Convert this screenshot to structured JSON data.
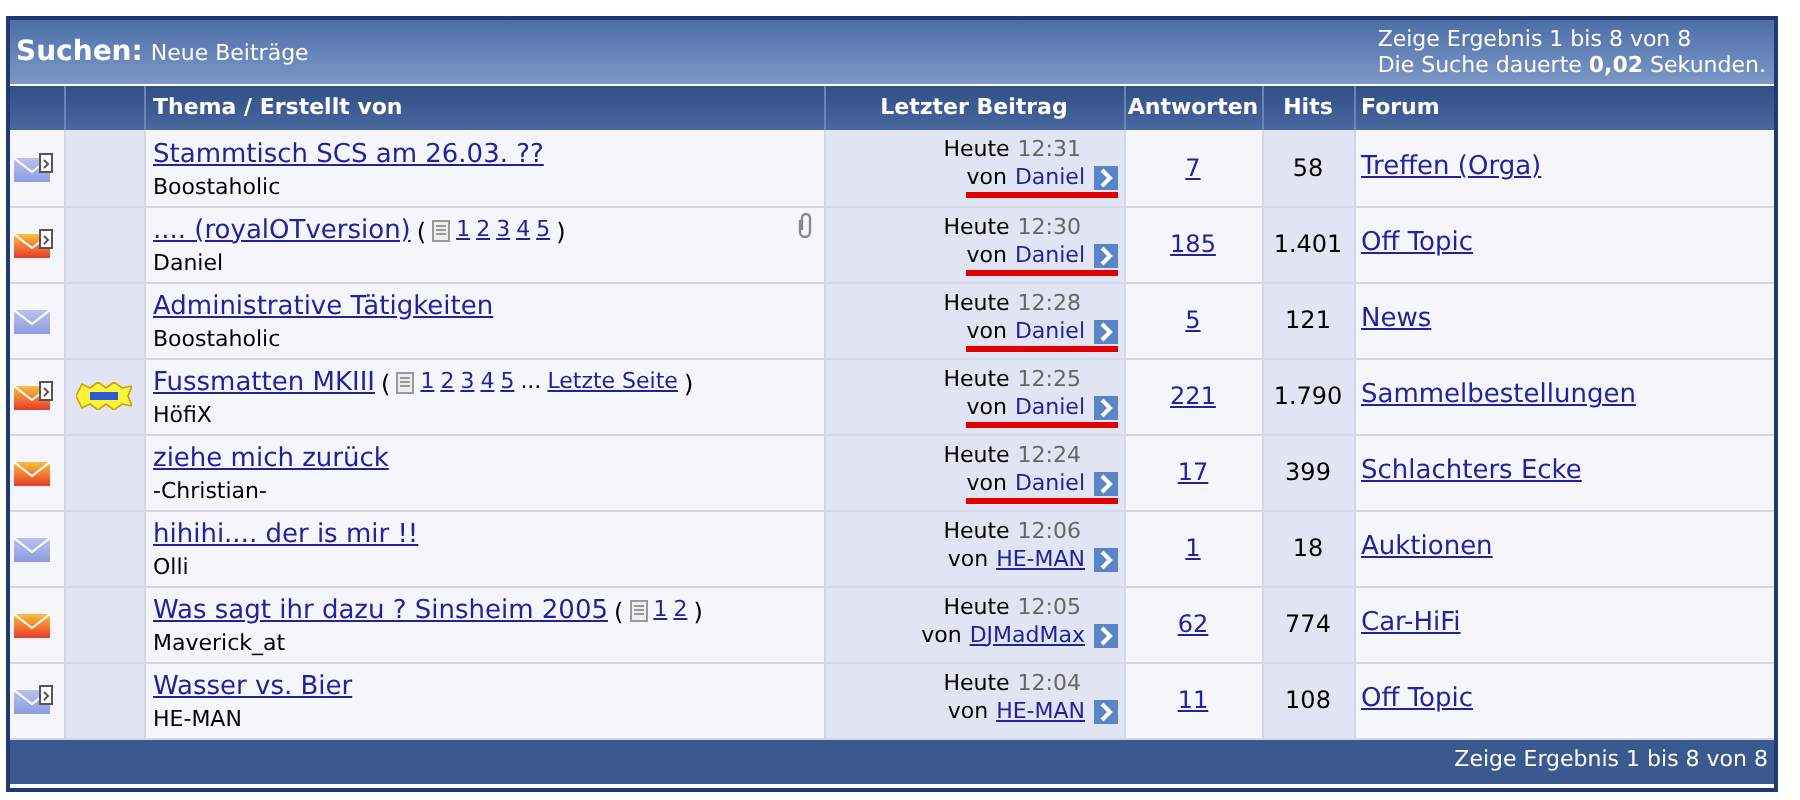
{
  "header": {
    "title": "Suchen:",
    "subtitle": "Neue Beiträge",
    "results": "Zeige Ergebnis 1 bis 8 von 8",
    "duration": "Die Suche dauerte **0,02** Sekunden."
  },
  "columns": [
    "Thema / Erstellt von",
    "Letzter Beitrag",
    "Antworten",
    "Hits",
    "Forum"
  ],
  "rows": [
    {
      "unread": false,
      "replied": true,
      "new": false,
      "title": "Stammtisch SCS am 26.03. ??",
      "pager": null,
      "attachment": false,
      "author": "Boostaholic",
      "day": "Heute",
      "time": "12:31",
      "von": "von",
      "last_by": "Daniel",
      "highlighted": true,
      "replies": "7",
      "hits": "58",
      "forum": "Treffen (Orga)"
    },
    {
      "unread": true,
      "replied": true,
      "new": false,
      "title": ".... (royalOTversion)",
      "pager": {
        "open": "(",
        "pages": [
          "1",
          "2",
          "3",
          "4",
          "5"
        ],
        "close": ")"
      },
      "attachment": true,
      "author": "Daniel",
      "day": "Heute",
      "time": "12:30",
      "von": "von",
      "last_by": "Daniel",
      "highlighted": true,
      "replies": "185",
      "hits": "1.401",
      "forum": "Off Topic"
    },
    {
      "unread": false,
      "replied": false,
      "new": false,
      "title": "Administrative Tätigkeiten",
      "pager": null,
      "attachment": false,
      "author": "Boostaholic",
      "day": "Heute",
      "time": "12:28",
      "von": "von",
      "last_by": "Daniel",
      "highlighted": true,
      "replies": "5",
      "hits": "121",
      "forum": "News"
    },
    {
      "unread": true,
      "replied": true,
      "new": true,
      "title": "Fussmatten MKIII",
      "pager": {
        "open": "(",
        "pages": [
          "1",
          "2",
          "3",
          "4",
          "5"
        ],
        "ellipsis": "...",
        "last_page": "Letzte Seite",
        "close": ")"
      },
      "attachment": false,
      "author": "HöfiX",
      "day": "Heute",
      "time": "12:25",
      "von": "von",
      "last_by": "Daniel",
      "highlighted": true,
      "replies": "221",
      "hits": "1.790",
      "forum": "Sammelbestellungen"
    },
    {
      "unread": true,
      "replied": false,
      "new": false,
      "title": "ziehe mich zurück",
      "pager": null,
      "attachment": false,
      "author": "-Christian-",
      "day": "Heute",
      "time": "12:24",
      "von": "von",
      "last_by": "Daniel",
      "highlighted": true,
      "replies": "17",
      "hits": "399",
      "forum": "Schlachters Ecke"
    },
    {
      "unread": false,
      "replied": false,
      "new": false,
      "title": "hihihi.... der is mir !!",
      "pager": null,
      "attachment": false,
      "author": "Olli",
      "day": "Heute",
      "time": "12:06",
      "von": "von",
      "last_by": "HE-MAN",
      "highlighted": false,
      "replies": "1",
      "hits": "18",
      "forum": "Auktionen"
    },
    {
      "unread": true,
      "replied": false,
      "new": false,
      "title": "Was sagt ihr dazu ? Sinsheim 2005",
      "pager": {
        "open": "(",
        "pages": [
          "1",
          "2"
        ],
        "close": ")"
      },
      "attachment": false,
      "author": "Maverick_at",
      "day": "Heute",
      "time": "12:05",
      "von": "von",
      "last_by": "DJMadMax",
      "highlighted": false,
      "replies": "62",
      "hits": "774",
      "forum": "Car-HiFi"
    },
    {
      "unread": false,
      "replied": true,
      "new": false,
      "title": "Wasser vs. Bier",
      "pager": null,
      "attachment": false,
      "author": "HE-MAN",
      "day": "Heute",
      "time": "12:04",
      "von": "von",
      "last_by": "HE-MAN",
      "highlighted": false,
      "replies": "11",
      "hits": "108",
      "forum": "Off Topic"
    }
  ],
  "footer": {
    "results": "Zeige Ergebnis 1 bis 8 von 8"
  }
}
